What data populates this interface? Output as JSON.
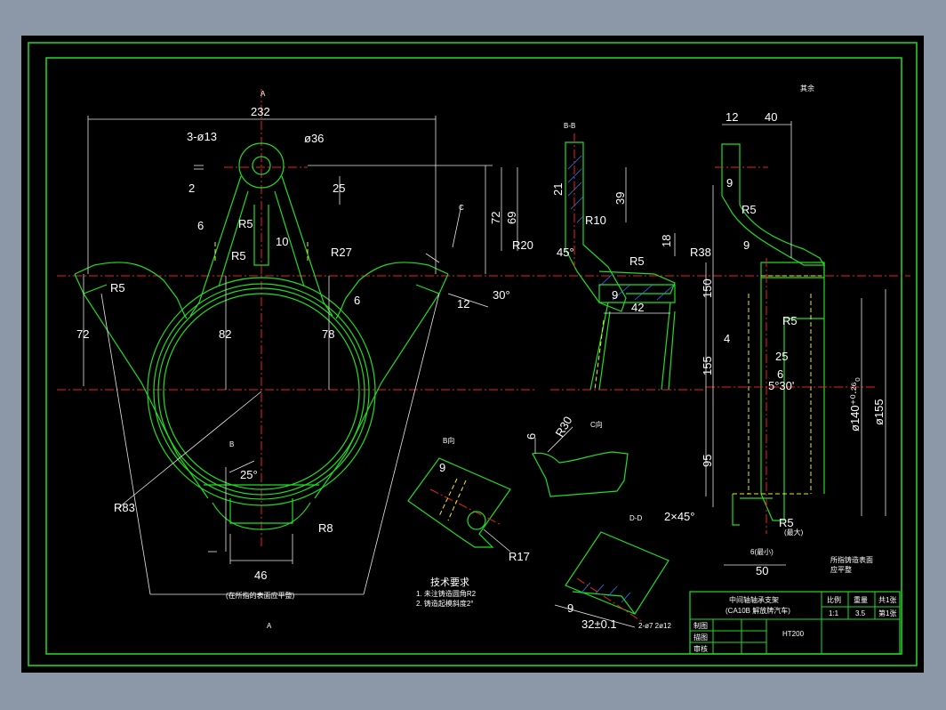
{
  "colors": {
    "background": "#8c97a8",
    "paper": "#000000",
    "outline": "#22dd22",
    "dimension": "#e8e8e8",
    "centerline": "#ee2222",
    "hidden": "#eeee22",
    "hatch": "#2a7cff"
  },
  "dims": {
    "d232": "232",
    "d3x13": "3-ø13",
    "d36": "ø36",
    "d2": "2",
    "d25a": "25",
    "d6a": "6",
    "dR5a": "R5",
    "d10": "10",
    "dR5b": "R5",
    "dR27": "R27",
    "dR5c": "R5",
    "d72a": "72",
    "d82": "82",
    "d78": "78",
    "d6b": "6",
    "d12": "12",
    "d30deg": "30°",
    "dR83": "R83",
    "d25deg": "25°",
    "dR8": "R8",
    "d46": "46",
    "d72b": "72",
    "d69": "69",
    "d21": "21",
    "d39": "39",
    "dR10": "R10",
    "dR20": "R20",
    "d45deg": "45°",
    "d18": "18",
    "dR38": "R38",
    "dR5d": "R5",
    "d9a": "9",
    "d42": "42",
    "d12b": "12",
    "d40": "40",
    "d9b": "9",
    "dR5e": "R5",
    "d9c": "9",
    "d150": "150",
    "dR5f": "R5",
    "d4": "4",
    "d25b": "25",
    "d6c": "6",
    "d5deg30": "5°30'",
    "d155a": "155",
    "d140": "ø140⁺⁰·²⁶₀",
    "d155b": "ø155",
    "d95": "95",
    "d2x45": "2×45°",
    "dR5g": "R5",
    "dR5gNote": "(最大)",
    "d6min": "6(最小)",
    "d50": "50",
    "d6d": "6",
    "dR30": "R30",
    "d9d": "9",
    "dR17": "R17",
    "d9e": "9",
    "d32": "32±0.1"
  },
  "view_labels": {
    "top_a": "A",
    "bottom_a": "A",
    "b_b": "B-B",
    "c_view": "C向",
    "b_view": "B向",
    "d_d": "D-D",
    "arrow_c": "C",
    "arrow_b": "B",
    "arrow_d1": "D",
    "arrow_d2": "D"
  },
  "notes": {
    "under_base": "(在所指的表面应平整)",
    "tech_title": "技术要求",
    "tech_items": [
      "1. 未注铸造圆角R2",
      "2. 铸造起模斜度2°"
    ],
    "side_note_1": "所指铸造表面",
    "side_note_2": "应平整",
    "roughness_other": "其余",
    "dd_bottom": "2-ø7 2ø12"
  },
  "title_block": {
    "title_line1": "中间轴轴承支架",
    "title_line2": "(CA10B 解放牌汽车)",
    "h_ratio": "比例",
    "h_weight": "重量",
    "h_sheet": "共1张",
    "v_ratio": "1:1",
    "v_weight": "3.5",
    "v_sheet": "第1张",
    "r_draw": "制图",
    "r_design": "描图",
    "r_check": "审核",
    "material": "HT200"
  }
}
